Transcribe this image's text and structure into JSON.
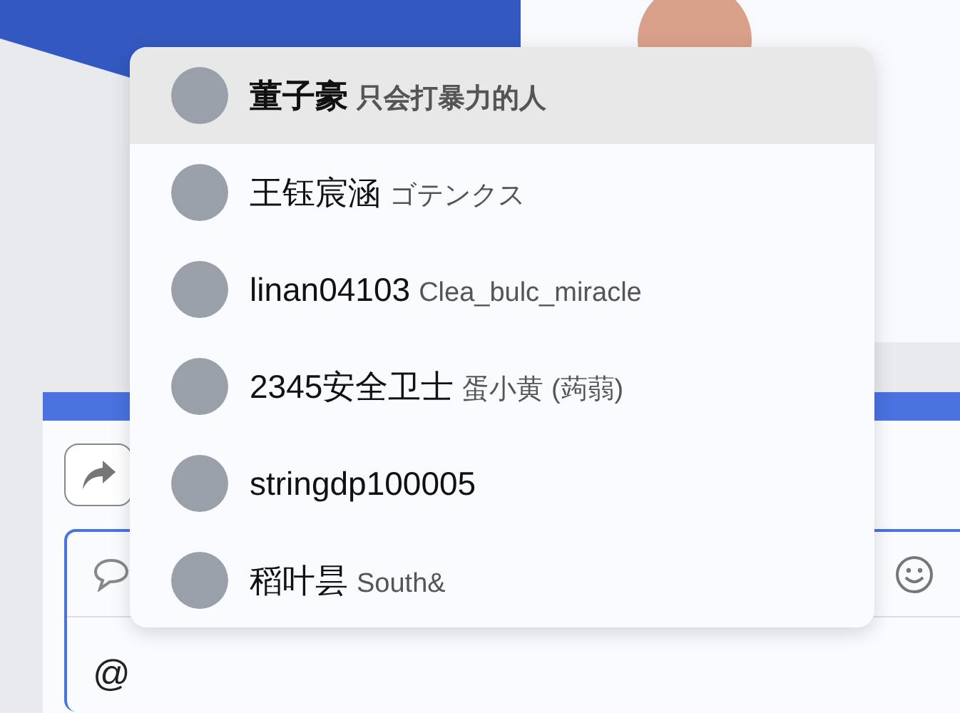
{
  "mention_menu": {
    "items": [
      {
        "name": "董子豪",
        "note": "只会打暴力的人",
        "selected": true
      },
      {
        "name": "王钰宸涵",
        "note": "ゴテンクス",
        "selected": false
      },
      {
        "name": "linan04103",
        "note": "Clea_bulc_miracle",
        "selected": false
      },
      {
        "name": "2345安全卫士",
        "note": "蛋小黄 (蒟蒻)",
        "selected": false
      },
      {
        "name": "stringdp100005",
        "selected": false
      },
      {
        "name": "稻叶昙",
        "note": "South&",
        "selected": false
      }
    ]
  },
  "composer": {
    "value": "@"
  }
}
